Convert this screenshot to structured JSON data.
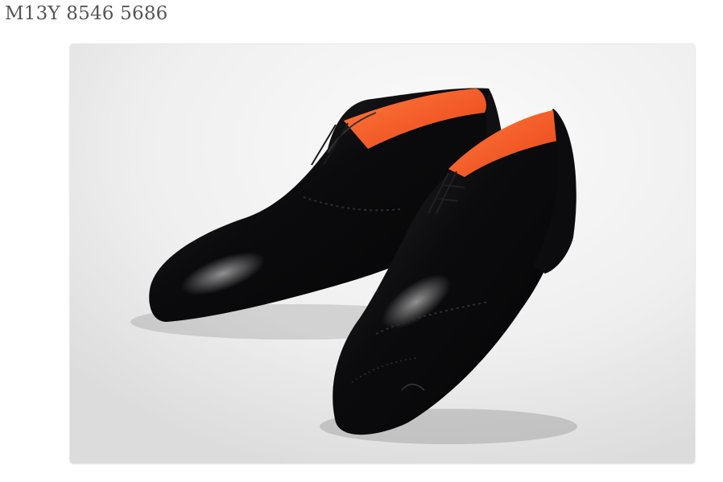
{
  "product": {
    "code": "M13Y 8546 5686"
  },
  "photo": {
    "subject": "shoes-image",
    "colors": {
      "leather": "#0e0e10",
      "lining": "#ff5a1f",
      "background": "#eeeeee"
    }
  }
}
